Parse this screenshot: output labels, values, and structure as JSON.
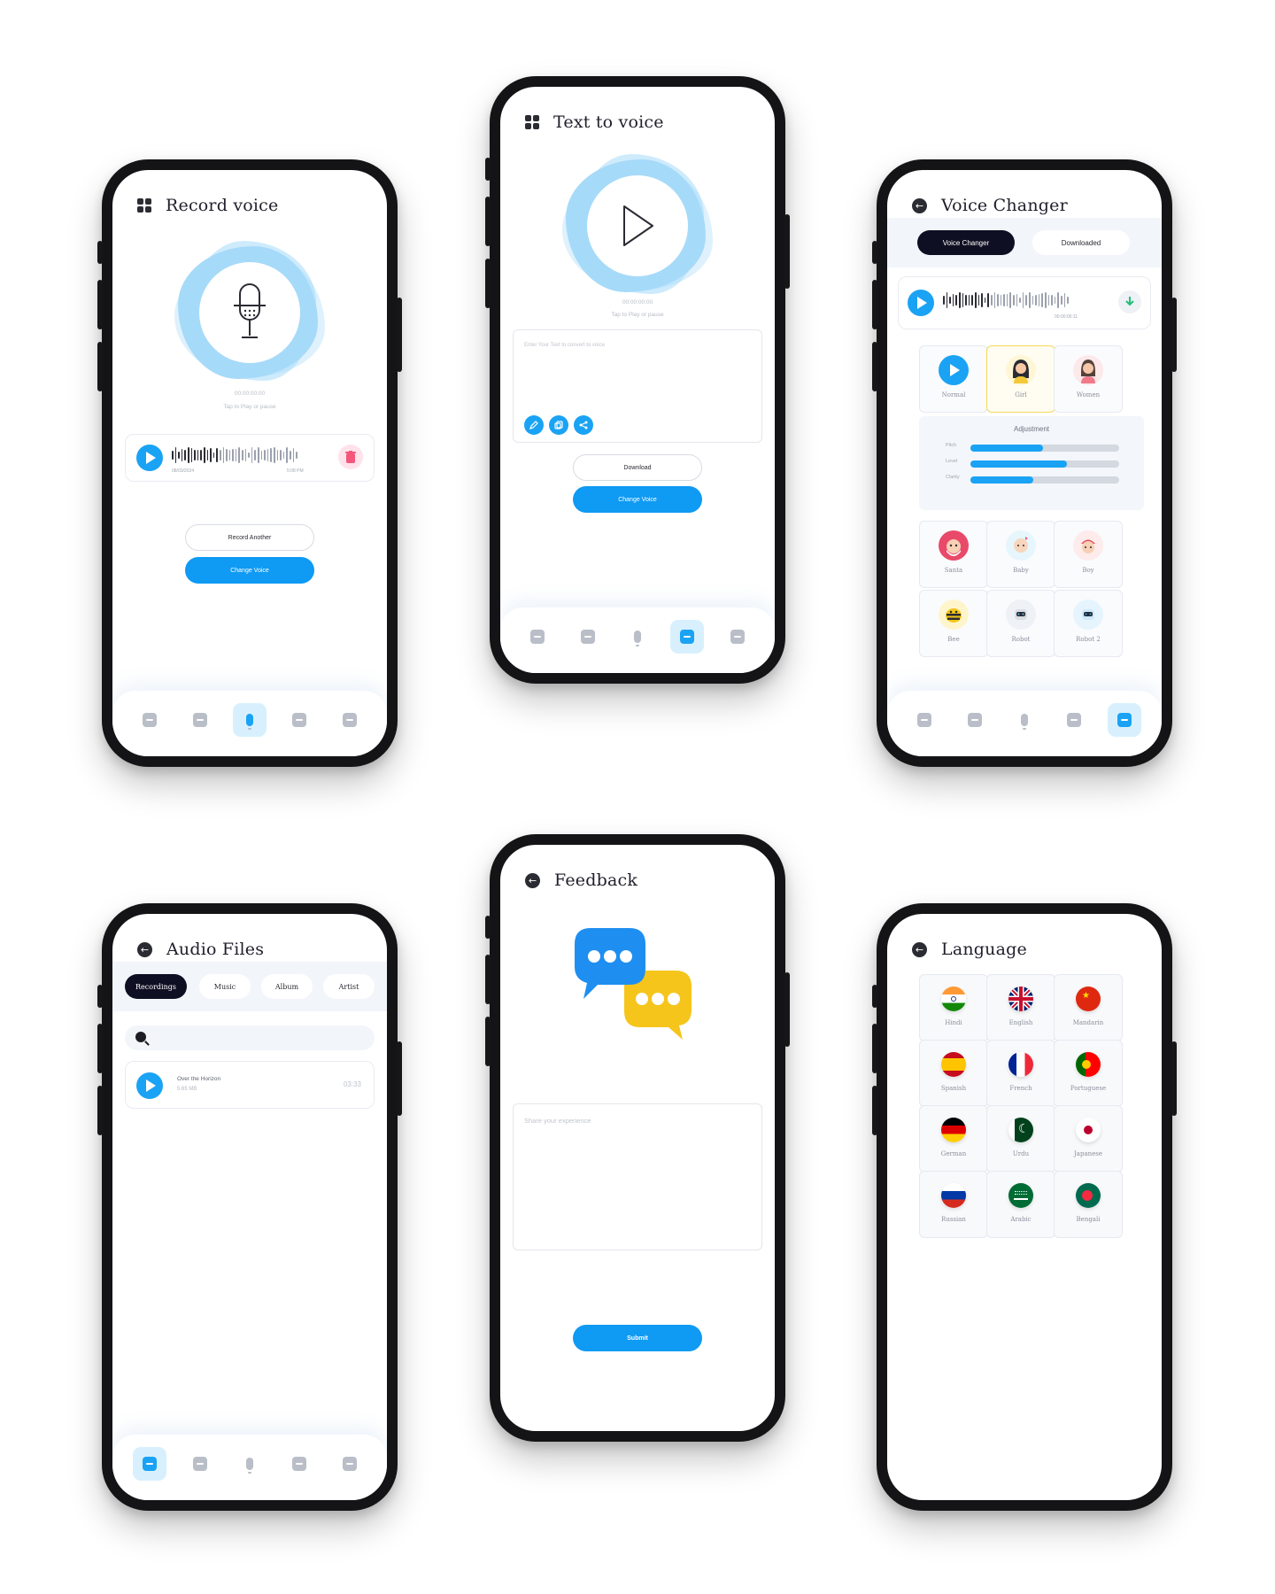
{
  "colors": {
    "accent": "#1aa3f4",
    "dark": "#0e0f22",
    "danger": "#f4577a",
    "selected_tile": "#f3d95c"
  },
  "record": {
    "title": "Record voice",
    "timer": "00:00:00:00",
    "hint": "Tap to Play or pause",
    "clip_date": "08/03/2024",
    "clip_time": "5:08 PM",
    "record_another": "Record Another",
    "change_voice": "Change Voice"
  },
  "tts": {
    "title": "Text to voice",
    "timer": "00:00:00:00",
    "hint": "Tap to Play or pause",
    "placeholder": "Enter Your Text to convert to voice",
    "download": "Download",
    "change_voice": "Change Voice"
  },
  "changer": {
    "title": "Voice Changer",
    "tab_active": "Voice Changer",
    "tab_other": "Downloaded",
    "clip_time": "00:00:00:11",
    "adjustment_title": "Adjustment",
    "sliders": [
      {
        "name": "Pitch",
        "value": 0.49
      },
      {
        "name": "Level",
        "value": 0.65
      },
      {
        "name": "Clarity",
        "value": 0.42
      }
    ],
    "voices": [
      "Normal",
      "Girl",
      "Women",
      "Santa",
      "Baby",
      "Boy",
      "Bee",
      "Robot",
      "Robot 2"
    ],
    "selected_voice": "Girl"
  },
  "audio_files": {
    "title": "Audio Files",
    "tabs": [
      "Recordings",
      "Music",
      "Album",
      "Artist"
    ],
    "active_tab": "Recordings",
    "item": {
      "name": "Over the Horizon",
      "size": "5.65 MB",
      "duration": "03:33"
    }
  },
  "feedback": {
    "title": "Feedback",
    "placeholder": "Share your experience",
    "submit": "Submit"
  },
  "language": {
    "title": "Language",
    "languages": [
      "Hindi",
      "English",
      "Mandarin",
      "Spanish",
      "French",
      "Portuguese",
      "German",
      "Urdu",
      "Japanese",
      "Russian",
      "Arabic",
      "Bengali"
    ]
  },
  "nav_icons": [
    "speaker-icon",
    "download-icon",
    "mic-icon",
    "text-to-voice-icon",
    "list-icon"
  ]
}
